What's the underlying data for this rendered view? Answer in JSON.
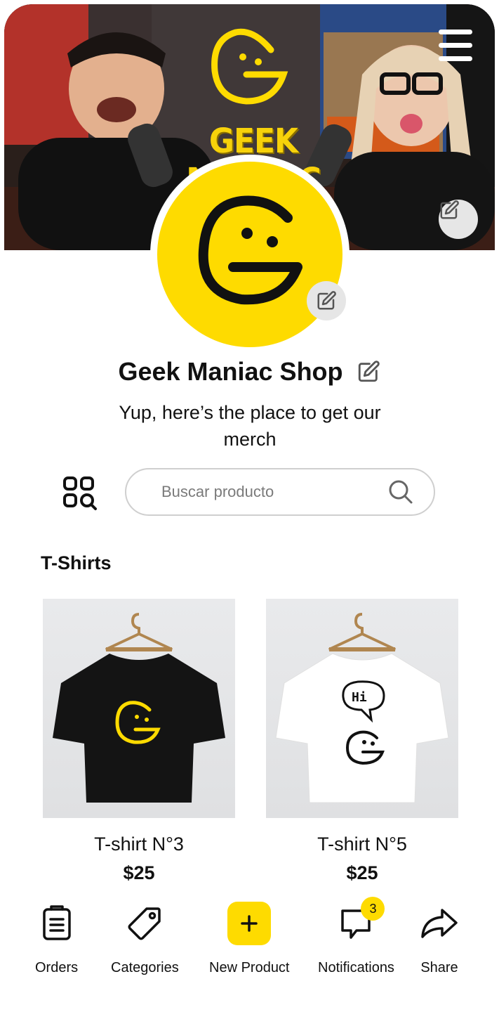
{
  "banner": {
    "brand_text": "GEEK MANIAC"
  },
  "shop": {
    "name": "Geek Maniac Shop",
    "description": "Yup, here’s the place to get our merch"
  },
  "search": {
    "placeholder": "Buscar producto"
  },
  "section": {
    "title": "T-Shirts"
  },
  "products": [
    {
      "name": "T-shirt N°3",
      "price": "$25",
      "shirt_color": "#141414",
      "print_color": "#fedb00"
    },
    {
      "name": "T-shirt N°5",
      "price": "$25",
      "shirt_color": "#ffffff",
      "print_color": "#111111",
      "print_text": "Hi"
    }
  ],
  "bottom_nav": {
    "orders": "Orders",
    "categories": "Categories",
    "new_product": "New Product",
    "notifications": "Notifications",
    "notifications_count": "3",
    "share": "Share"
  },
  "colors": {
    "accent": "#fedb00",
    "edit_button_bg": "#e6e6e6",
    "text": "#111111"
  }
}
